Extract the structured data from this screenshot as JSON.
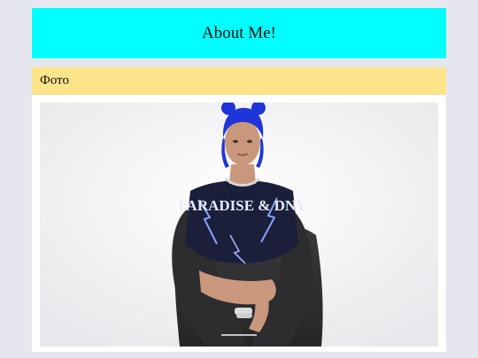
{
  "header": {
    "title": "About Me!"
  },
  "section": {
    "heading": "Фото",
    "photo_alt": "Фото",
    "shirt_text": "PARADISE & DNY"
  },
  "colors": {
    "page_bg": "#e6e6ee",
    "header_bg": "#00ffff",
    "section_head_bg": "#ffe58a",
    "photo_bg": "#f3f3f5",
    "hair": "#1f35d8"
  }
}
